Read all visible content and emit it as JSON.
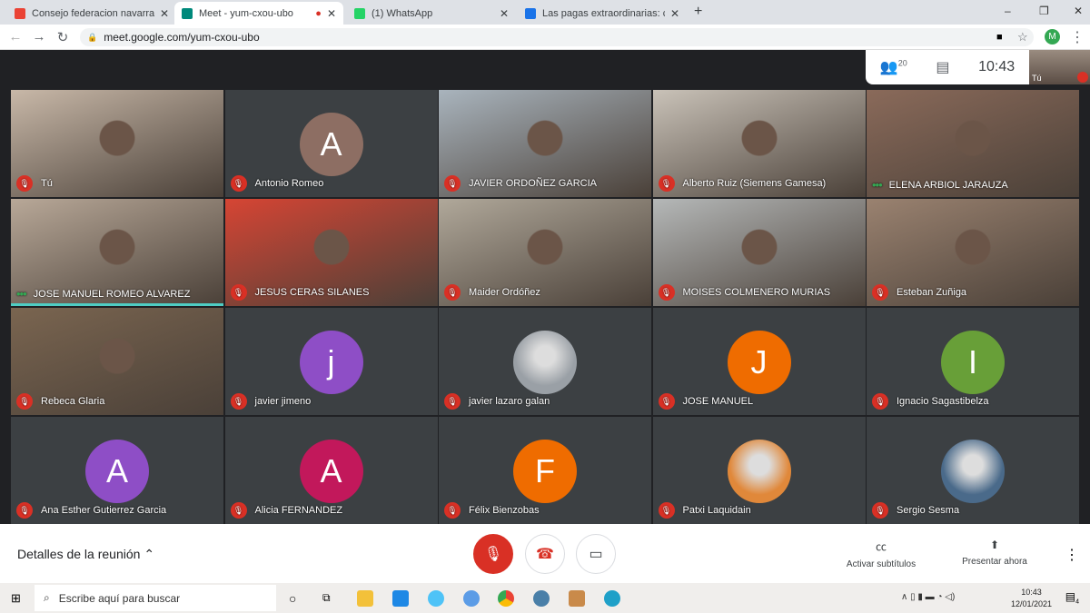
{
  "browser": {
    "tabs": [
      {
        "title": "Consejo federacion navarra - ma",
        "icon": "gmail-icon",
        "color": "#ea4335",
        "active": false
      },
      {
        "title": "Meet - yum-cxou-ubo",
        "icon": "meet-icon",
        "color": "#00897b",
        "active": true,
        "recording": true
      },
      {
        "title": "(1) WhatsApp",
        "icon": "whatsapp-icon",
        "color": "#25d366",
        "active": false
      },
      {
        "title": "Las pagas extraordinarias: como",
        "icon": "doc-icon",
        "color": "#1a73e8",
        "active": false
      }
    ],
    "url": "meet.google.com/yum-cxou-ubo"
  },
  "meeting": {
    "participants_count": "20",
    "time": "10:43",
    "self_label": "Tú",
    "tiles": [
      {
        "name": "Tú",
        "type": "video",
        "bg": "#c8b8a8"
      },
      {
        "name": "Antonio Romeo",
        "type": "avatar",
        "letter": "A",
        "color": "#8d6e63"
      },
      {
        "name": "JAVIER ORDOÑEZ GARCIA",
        "type": "video",
        "bg": "#a9b4bd"
      },
      {
        "name": "Alberto Ruiz (Siemens Gamesa)",
        "type": "video",
        "bg": "#c9c2b8"
      },
      {
        "name": "ELENA ARBIOL JARAUZA",
        "type": "video",
        "bg": "#8a6a5a",
        "status": "speaking-dots"
      },
      {
        "name": "JOSE MANUEL ROMEO ALVAREZ",
        "type": "video",
        "bg": "#b8a898",
        "status": "speaking-dots",
        "highlight": true
      },
      {
        "name": "JESUS CERAS SILANES",
        "type": "video",
        "bg": "#d64534"
      },
      {
        "name": "Maider Ordóñez",
        "type": "video",
        "bg": "#b0a89a"
      },
      {
        "name": "MOISES COLMENERO MURIAS",
        "type": "video",
        "bg": "#b5b8b8"
      },
      {
        "name": "Esteban Zuñiga",
        "type": "video",
        "bg": "#9a8270"
      },
      {
        "name": "Rebeca Glaria",
        "type": "video",
        "bg": "#7a6550"
      },
      {
        "name": "javier jimeno",
        "type": "avatar",
        "letter": "j",
        "color": "#8e4ec6"
      },
      {
        "name": "javier lazaro galan",
        "type": "photo",
        "color": "#9aa0a6"
      },
      {
        "name": "JOSE MANUEL",
        "type": "avatar",
        "letter": "J",
        "color": "#ef6c00"
      },
      {
        "name": "Ignacio Sagastibelza",
        "type": "avatar",
        "letter": "I",
        "color": "#689f38"
      },
      {
        "name": "Ana Esther Gutierrez Garcia",
        "type": "avatar",
        "letter": "A",
        "color": "#8e4ec6"
      },
      {
        "name": "Alicia FERNANDEZ",
        "type": "avatar",
        "letter": "A",
        "color": "#c2185b"
      },
      {
        "name": "Félix Bienzobas",
        "type": "avatar",
        "letter": "F",
        "color": "#ef6c00"
      },
      {
        "name": "Patxi Laquidain",
        "type": "photo",
        "color": "#e0883a"
      },
      {
        "name": "Sergio Sesma",
        "type": "photo",
        "color": "#4a6a8a"
      }
    ]
  },
  "bottom_bar": {
    "details": "Detalles de la reunión",
    "captions": "Activar subtítulos",
    "present": "Presentar ahora"
  },
  "taskbar": {
    "search_placeholder": "Escribe aquí para buscar",
    "time": "10:43",
    "date": "12/01/2021",
    "notifications": "4"
  }
}
